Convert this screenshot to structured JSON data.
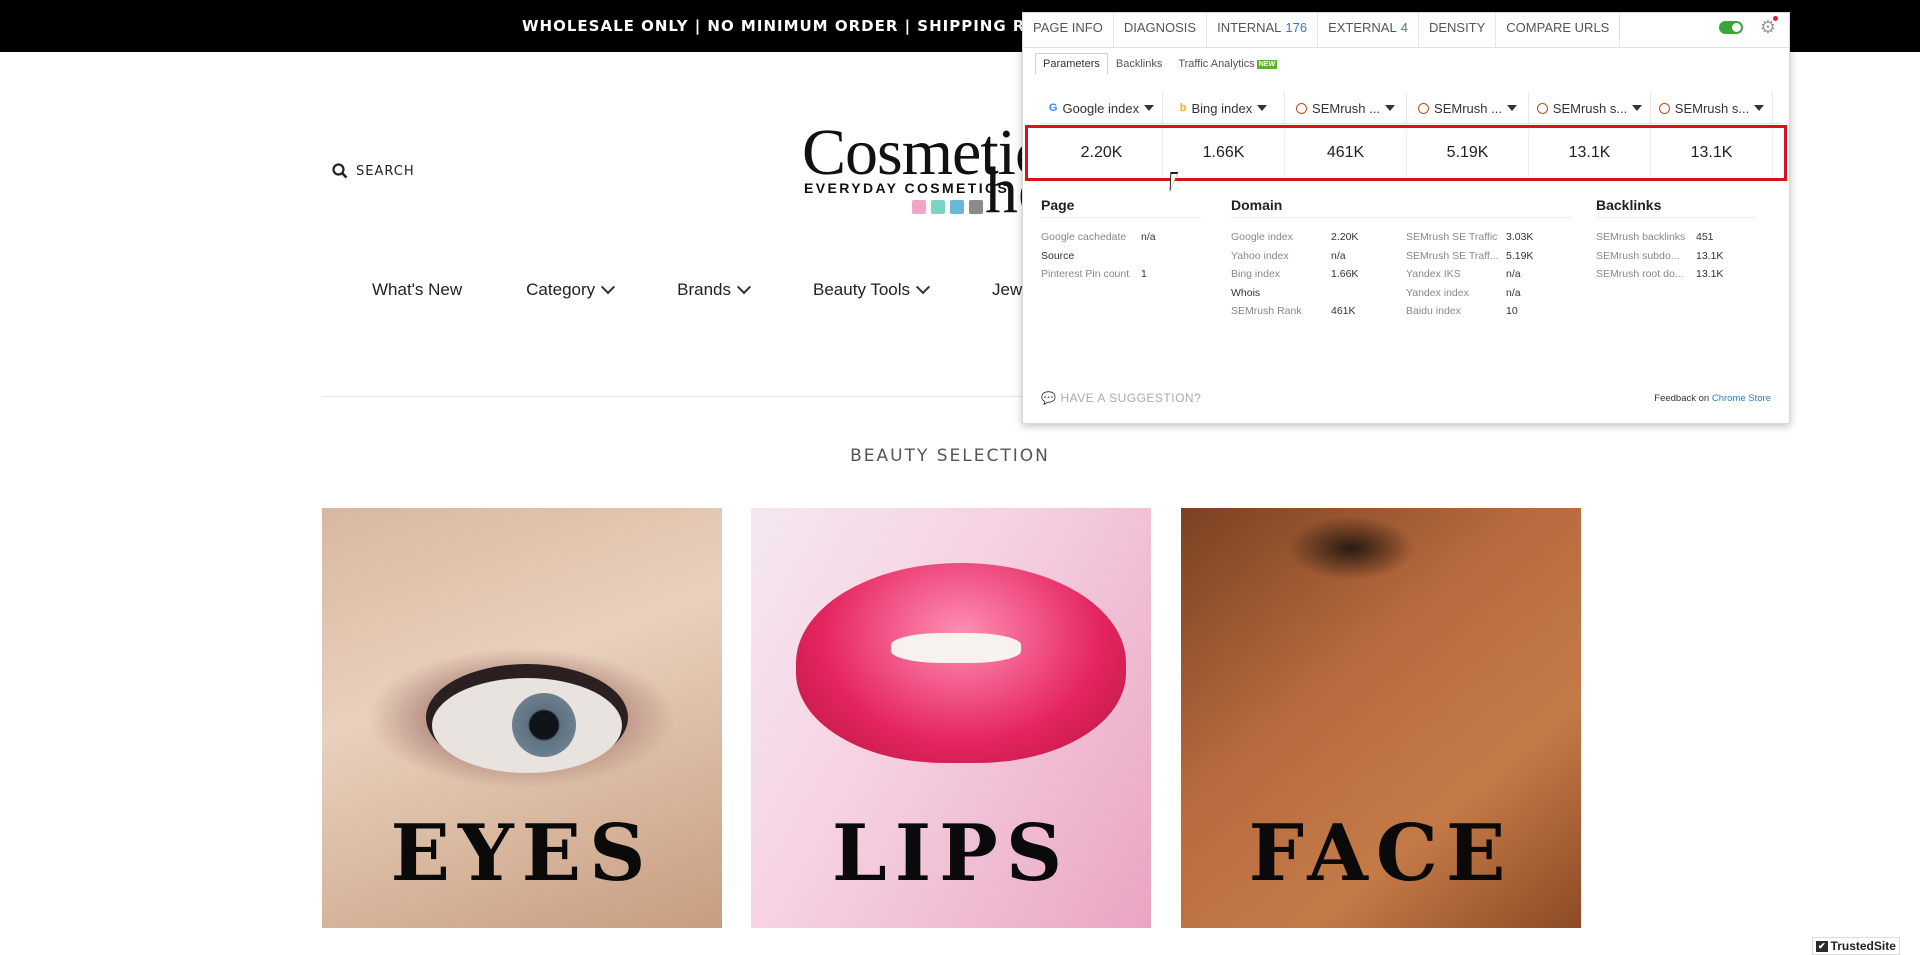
{
  "announcement": "WHOLESALE ONLY | NO MINIMUM ORDER | SHIPPING RATE WILL B",
  "header": {
    "search_label": "SEARCH",
    "logo_text": "Cosmetic",
    "logo_text2": "he",
    "logo_tagline": "EVERYDAY COSMETICS",
    "logo_swatch_colors": [
      "#f2a6c6",
      "#7fd3c6",
      "#6ab8d8",
      "#8a8a8a"
    ]
  },
  "nav": {
    "items": [
      {
        "label": "What's New",
        "has_dropdown": false
      },
      {
        "label": "Category",
        "has_dropdown": true
      },
      {
        "label": "Brands",
        "has_dropdown": true
      },
      {
        "label": "Beauty Tools",
        "has_dropdown": true
      },
      {
        "label": "Jewe",
        "has_dropdown": false
      }
    ]
  },
  "section_title": "BEAUTY SELECTION",
  "tiles": [
    {
      "label": "EYES"
    },
    {
      "label": "LIPS"
    },
    {
      "label": "FACE"
    }
  ],
  "extension": {
    "tabs": [
      {
        "label": "PAGE INFO",
        "count": ""
      },
      {
        "label": "DIAGNOSIS",
        "count": ""
      },
      {
        "label": "INTERNAL",
        "count": "176"
      },
      {
        "label": "EXTERNAL",
        "count": "4"
      },
      {
        "label": "DENSITY",
        "count": ""
      },
      {
        "label": "COMPARE URLS",
        "count": ""
      }
    ],
    "subtabs": [
      "Parameters",
      "Backlinks",
      "Traffic Analytics"
    ],
    "new_badge": "NEW",
    "metrics": [
      {
        "label": "Google index",
        "value": "2.20K",
        "icon": "google-icon"
      },
      {
        "label": "Bing index",
        "value": "1.66K",
        "icon": "bing-icon"
      },
      {
        "label": "SEMrush ...",
        "value": "461K",
        "icon": "semrush-icon"
      },
      {
        "label": "SEMrush ...",
        "value": "5.19K",
        "icon": "semrush-icon"
      },
      {
        "label": "SEMrush s...",
        "value": "13.1K",
        "icon": "semrush-icon"
      },
      {
        "label": "SEMrush s...",
        "value": "13.1K",
        "icon": "semrush-icon"
      }
    ],
    "page": {
      "title": "Page",
      "rows": [
        {
          "k": "Google cachedate",
          "v": "n/a"
        },
        {
          "k": "Source",
          "v": ""
        },
        {
          "k": "Pinterest Pin count",
          "v": "1"
        }
      ]
    },
    "domain": {
      "title": "Domain",
      "left": [
        {
          "k": "Google index",
          "v": "2.20K"
        },
        {
          "k": "Yahoo index",
          "v": "n/a"
        },
        {
          "k": "Bing index",
          "v": "1.66K"
        },
        {
          "k": "Whois",
          "v": ""
        },
        {
          "k": "SEMrush Rank",
          "v": "461K"
        }
      ],
      "right": [
        {
          "k": "SEMrush SE Traffic",
          "v": "3.03K"
        },
        {
          "k": "SEMrush SE Traff...",
          "v": "5.19K"
        },
        {
          "k": "Yandex IKS",
          "v": "n/a"
        },
        {
          "k": "Yandex index",
          "v": "n/a"
        },
        {
          "k": "Baidu index",
          "v": "10"
        }
      ]
    },
    "backlinks": {
      "title": "Backlinks",
      "rows": [
        {
          "k": "SEMrush backlinks",
          "v": "451"
        },
        {
          "k": "SEMrush subdo...",
          "v": "13.1K"
        },
        {
          "k": "SEMrush root do...",
          "v": "13.1K"
        }
      ]
    },
    "suggestion": "HAVE A SUGGESTION?",
    "feedback_prefix": "Feedback on",
    "feedback_link": "Chrome Store"
  },
  "trusted_badge": "TrustedSite"
}
